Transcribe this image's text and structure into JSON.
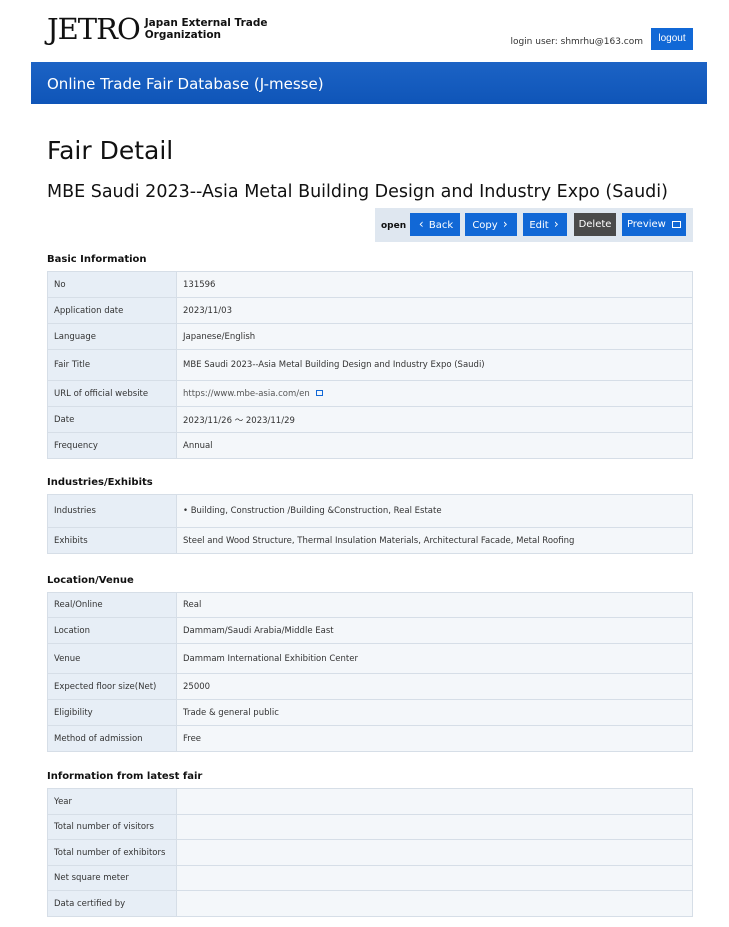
{
  "header": {
    "logo_mark": "JETRO",
    "logo_text_line1": "Japan External Trade",
    "logo_text_line2": "Organization",
    "login_label": "login user:",
    "login_email": "shmrhu@163.com",
    "logout_label": "logout"
  },
  "banner": {
    "title": "Online Trade Fair Database (J-messe)"
  },
  "page": {
    "title": "Fair Detail",
    "fair_name": "MBE Saudi 2023--Asia Metal Building Design and Industry Expo (Saudi)"
  },
  "actions": {
    "status": "open",
    "back": "Back",
    "copy": "Copy",
    "edit": "Edit",
    "delete": "Delete",
    "preview": "Preview"
  },
  "basic": {
    "title": "Basic Information",
    "rows": [
      {
        "label": "No",
        "value": "131596"
      },
      {
        "label": "Application date",
        "value": "2023/11/03"
      },
      {
        "label": "Language",
        "value": "Japanese/English"
      },
      {
        "label": "Fair Title",
        "value": "MBE Saudi 2023--Asia Metal Building Design and Industry Expo (Saudi)"
      },
      {
        "label": "URL of official website",
        "value": "https://www.mbe-asia.com/en"
      },
      {
        "label": "Date",
        "value": "2023/11/26 ～ 2023/11/29"
      },
      {
        "label": "Frequency",
        "value": "Annual"
      }
    ]
  },
  "industries": {
    "title": "Industries/Exhibits",
    "rows": [
      {
        "label": "Industries",
        "value": "•  Building, Construction /Building &Construction, Real Estate"
      },
      {
        "label": "Exhibits",
        "value": "Steel and Wood Structure, Thermal Insulation Materials, Architectural Facade, Metal Roofing"
      }
    ]
  },
  "location": {
    "title": "Location/Venue",
    "rows": [
      {
        "label": "Real/Online",
        "value": "Real"
      },
      {
        "label": "Location",
        "value": "Dammam/Saudi Arabia/Middle East"
      },
      {
        "label": "Venue",
        "value": "Dammam International Exhibition Center"
      },
      {
        "label": "Expected floor size(Net)",
        "value": "25000"
      },
      {
        "label": "Eligibility",
        "value": "Trade & general public"
      },
      {
        "label": "Method of admission",
        "value": "Free"
      }
    ]
  },
  "latest": {
    "title": "Information from latest fair",
    "rows": [
      {
        "label": "Year",
        "value": ""
      },
      {
        "label": "Total number of visitors",
        "value": ""
      },
      {
        "label": "Total number of exhibitors",
        "value": ""
      },
      {
        "label": "Net square meter",
        "value": ""
      },
      {
        "label": "Data certified by",
        "value": ""
      }
    ]
  }
}
